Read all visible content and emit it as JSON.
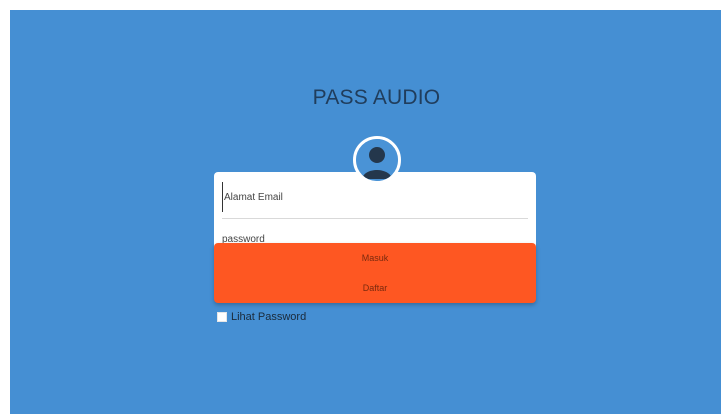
{
  "app_title": "PASS AUDIO",
  "avatar_icon": "user-icon",
  "login_form": {
    "email_placeholder": "Alamat Email",
    "password_placeholder": "password"
  },
  "buttons": {
    "login_label": "Masuk",
    "register_label": "Daftar"
  },
  "show_password_label": "Lihat Password",
  "colors": {
    "background": "#458fd3",
    "button": "#fe5722",
    "title": "#203d5c"
  }
}
